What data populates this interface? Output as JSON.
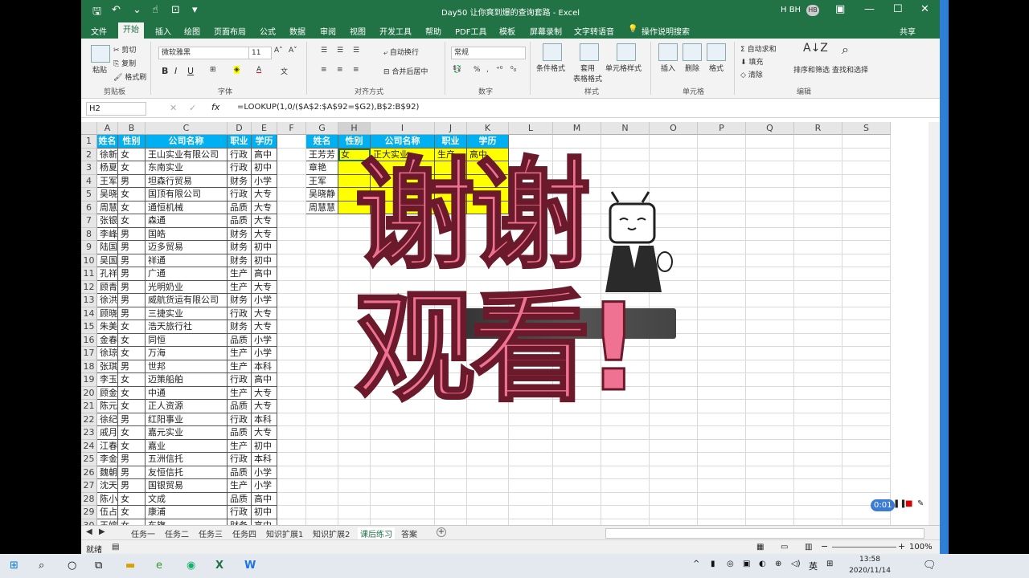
{
  "titlebar": {
    "doc_title": "Day50 让你爽到爆的查询套路 - Excel",
    "user": "H BH",
    "avatar": "HB"
  },
  "tabs": [
    "文件",
    "开始",
    "插入",
    "绘图",
    "页面布局",
    "公式",
    "数据",
    "审阅",
    "视图",
    "开发工具",
    "帮助",
    "PDF工具",
    "模板",
    "屏幕录制",
    "文字转语音",
    "操作说明搜索",
    "共享"
  ],
  "ribbon": {
    "paste": "粘贴",
    "cut": "剪切",
    "copy": "复制",
    "format_painter": "格式刷",
    "clipboard": "剪贴板",
    "font_name": "微软雅黑",
    "font_size": "11",
    "bold": "B",
    "italic": "I",
    "underline": "U",
    "font_group": "字体",
    "wrap": "自动换行",
    "merge": "合并后居中",
    "align_group": "对齐方式",
    "number_format": "常规",
    "number_group": "数字",
    "cond_format": "条件格式",
    "table_format": "套用\n表格格式",
    "cell_style": "单元格样式",
    "style_group": "样式",
    "insert": "插入",
    "delete": "删除",
    "format": "格式",
    "cells_group": "单元格",
    "autosum": "自动求和",
    "fill": "填充",
    "clear": "清除",
    "sort_filter": "排序和筛选",
    "find_select": "查找和选择",
    "edit_group": "编辑"
  },
  "formula_bar": {
    "name_box": "H2",
    "fx": "fx",
    "formula": "=LOOKUP(1,0/($A$2:$A$92=$G2),B$2:B$92)"
  },
  "columns": [
    "A",
    "B",
    "C",
    "D",
    "E",
    "F",
    "G",
    "H",
    "I",
    "J",
    "K",
    "L",
    "M",
    "N",
    "O",
    "P",
    "Q",
    "R",
    "S"
  ],
  "main_headers": [
    "姓名",
    "性别",
    "公司名称",
    "职业",
    "学历"
  ],
  "rows": [
    [
      "徐新凯",
      "女",
      "王山实业有限公司",
      "行政",
      "高中"
    ],
    [
      "杨夏丽",
      "女",
      "东南实业",
      "行政",
      "初中"
    ],
    [
      "王军",
      "男",
      "坦森行贸易",
      "财务",
      "小学"
    ],
    [
      "吴晓静",
      "女",
      "国顶有限公司",
      "行政",
      "大专"
    ],
    [
      "周慧慧",
      "女",
      "通恒机械",
      "品质",
      "大专"
    ],
    [
      "张银红",
      "女",
      "森通",
      "品质",
      "大专"
    ],
    [
      "李峰",
      "男",
      "国皓",
      "财务",
      "大专"
    ],
    [
      "陆国峰",
      "男",
      "迈多贸易",
      "财务",
      "初中"
    ],
    [
      "吴国辉",
      "男",
      "祥通",
      "财务",
      "初中"
    ],
    [
      "孔祥龙",
      "男",
      "广通",
      "生产",
      "高中"
    ],
    [
      "顾青青",
      "男",
      "光明奶业",
      "生产",
      "大专"
    ],
    [
      "徐洪奎",
      "男",
      "威航货运有限公司",
      "财务",
      "小学"
    ],
    [
      "顾晓年",
      "男",
      "三捷实业",
      "行政",
      "大专"
    ],
    [
      "朱美蓉",
      "女",
      "浩天旅行社",
      "财务",
      "大专"
    ],
    [
      "金春梅",
      "女",
      "同恒",
      "品质",
      "小学"
    ],
    [
      "徐琼",
      "女",
      "万海",
      "生产",
      "小学"
    ],
    [
      "张琪",
      "男",
      "世邦",
      "生产",
      "本科"
    ],
    [
      "李玉妹",
      "女",
      "迈策船舶",
      "行政",
      "高中"
    ],
    [
      "顾金花",
      "女",
      "中通",
      "生产",
      "大专"
    ],
    [
      "陈元娣",
      "女",
      "正人资源",
      "品质",
      "大专"
    ],
    [
      "徐纪昌",
      "男",
      "红阳事业",
      "行政",
      "本科"
    ],
    [
      "戚月英",
      "女",
      "嘉元实业",
      "品质",
      "大专"
    ],
    [
      "江春丽",
      "女",
      "嘉业",
      "生产",
      "初中"
    ],
    [
      "李金弟",
      "男",
      "五洲信托",
      "行政",
      "本科"
    ],
    [
      "魏朝斌",
      "男",
      "友恒信托",
      "品质",
      "小学"
    ],
    [
      "沈天庆",
      "男",
      "国银贸易",
      "生产",
      "小学"
    ],
    [
      "陈小琴",
      "女",
      "文成",
      "品质",
      "高中"
    ],
    [
      "伍占丽",
      "女",
      "康浦",
      "行政",
      "初中"
    ],
    [
      "王婷婷",
      "女",
      "东旗",
      "财务",
      "高中"
    ]
  ],
  "lookup": {
    "headers": [
      "姓名",
      "性别",
      "公司名称",
      "职业",
      "学历"
    ],
    "names": [
      "王芳芳",
      "章艳",
      "王军",
      "吴晓静",
      "周慧慧"
    ],
    "row1": [
      "女",
      "正大实业",
      "生产",
      "高中"
    ]
  },
  "overlay": {
    "line1": "谢谢",
    "line2": "观看!"
  },
  "sheets": [
    "任务一",
    "任务二",
    "任务三",
    "任务四",
    "知识扩展1",
    "知识扩展2",
    "课后练习",
    "答案"
  ],
  "active_sheet": "课后练习",
  "status": {
    "ready": "就绪",
    "zoom": "100%"
  },
  "taskbar": {
    "time": "13:58",
    "date": "2020/11/14",
    "ime": "英"
  },
  "colors": {
    "excel_green": "#217346",
    "header_blue": "#00b0f0",
    "highlight": "#ffff00",
    "overlay_pink": "#f07292"
  }
}
